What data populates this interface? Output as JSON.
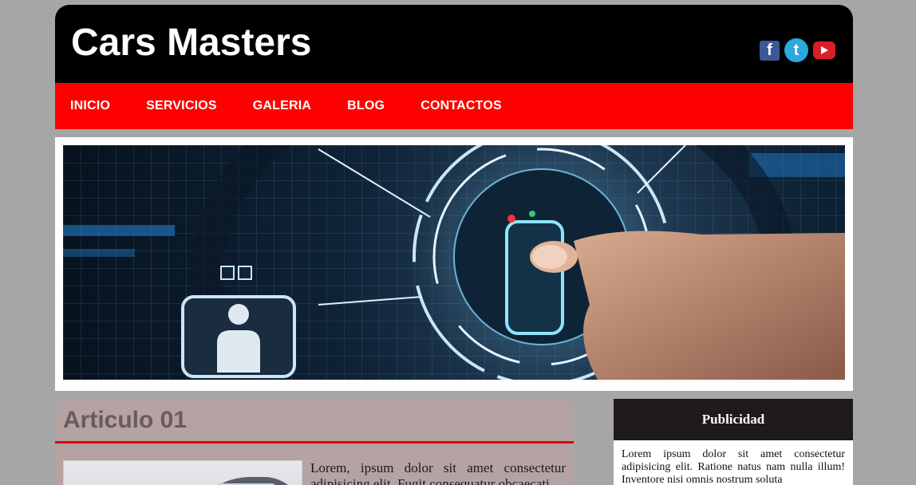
{
  "header": {
    "site_title": "Cars Masters",
    "social": {
      "facebook_glyph": "f",
      "twitter_glyph": "t"
    }
  },
  "nav": {
    "items": [
      {
        "label": "INICIO"
      },
      {
        "label": "SERVICIOS"
      },
      {
        "label": "GALERIA"
      },
      {
        "label": "BLOG"
      },
      {
        "label": "CONTACTOS"
      }
    ]
  },
  "banner": {
    "description_icon": "fingerprint-touch-tech-image"
  },
  "article": {
    "title": "Articulo 01",
    "text": "Lorem, ipsum dolor sit amet consectetur adipisicing elit. Fugit consequatur obcaecati"
  },
  "sidebar": {
    "title": "Publicidad",
    "text": "Lorem ipsum dolor sit amet consectetur adipisicing elit. Ratione natus nam nulla illum! Inventore nisi omnis nostrum soluta"
  },
  "colors": {
    "background": "#a6a6a6",
    "header": "#000000",
    "nav": "#ff0000",
    "article_bg": "#b5a2a2",
    "sidebar_head": "#1f1b1b"
  }
}
